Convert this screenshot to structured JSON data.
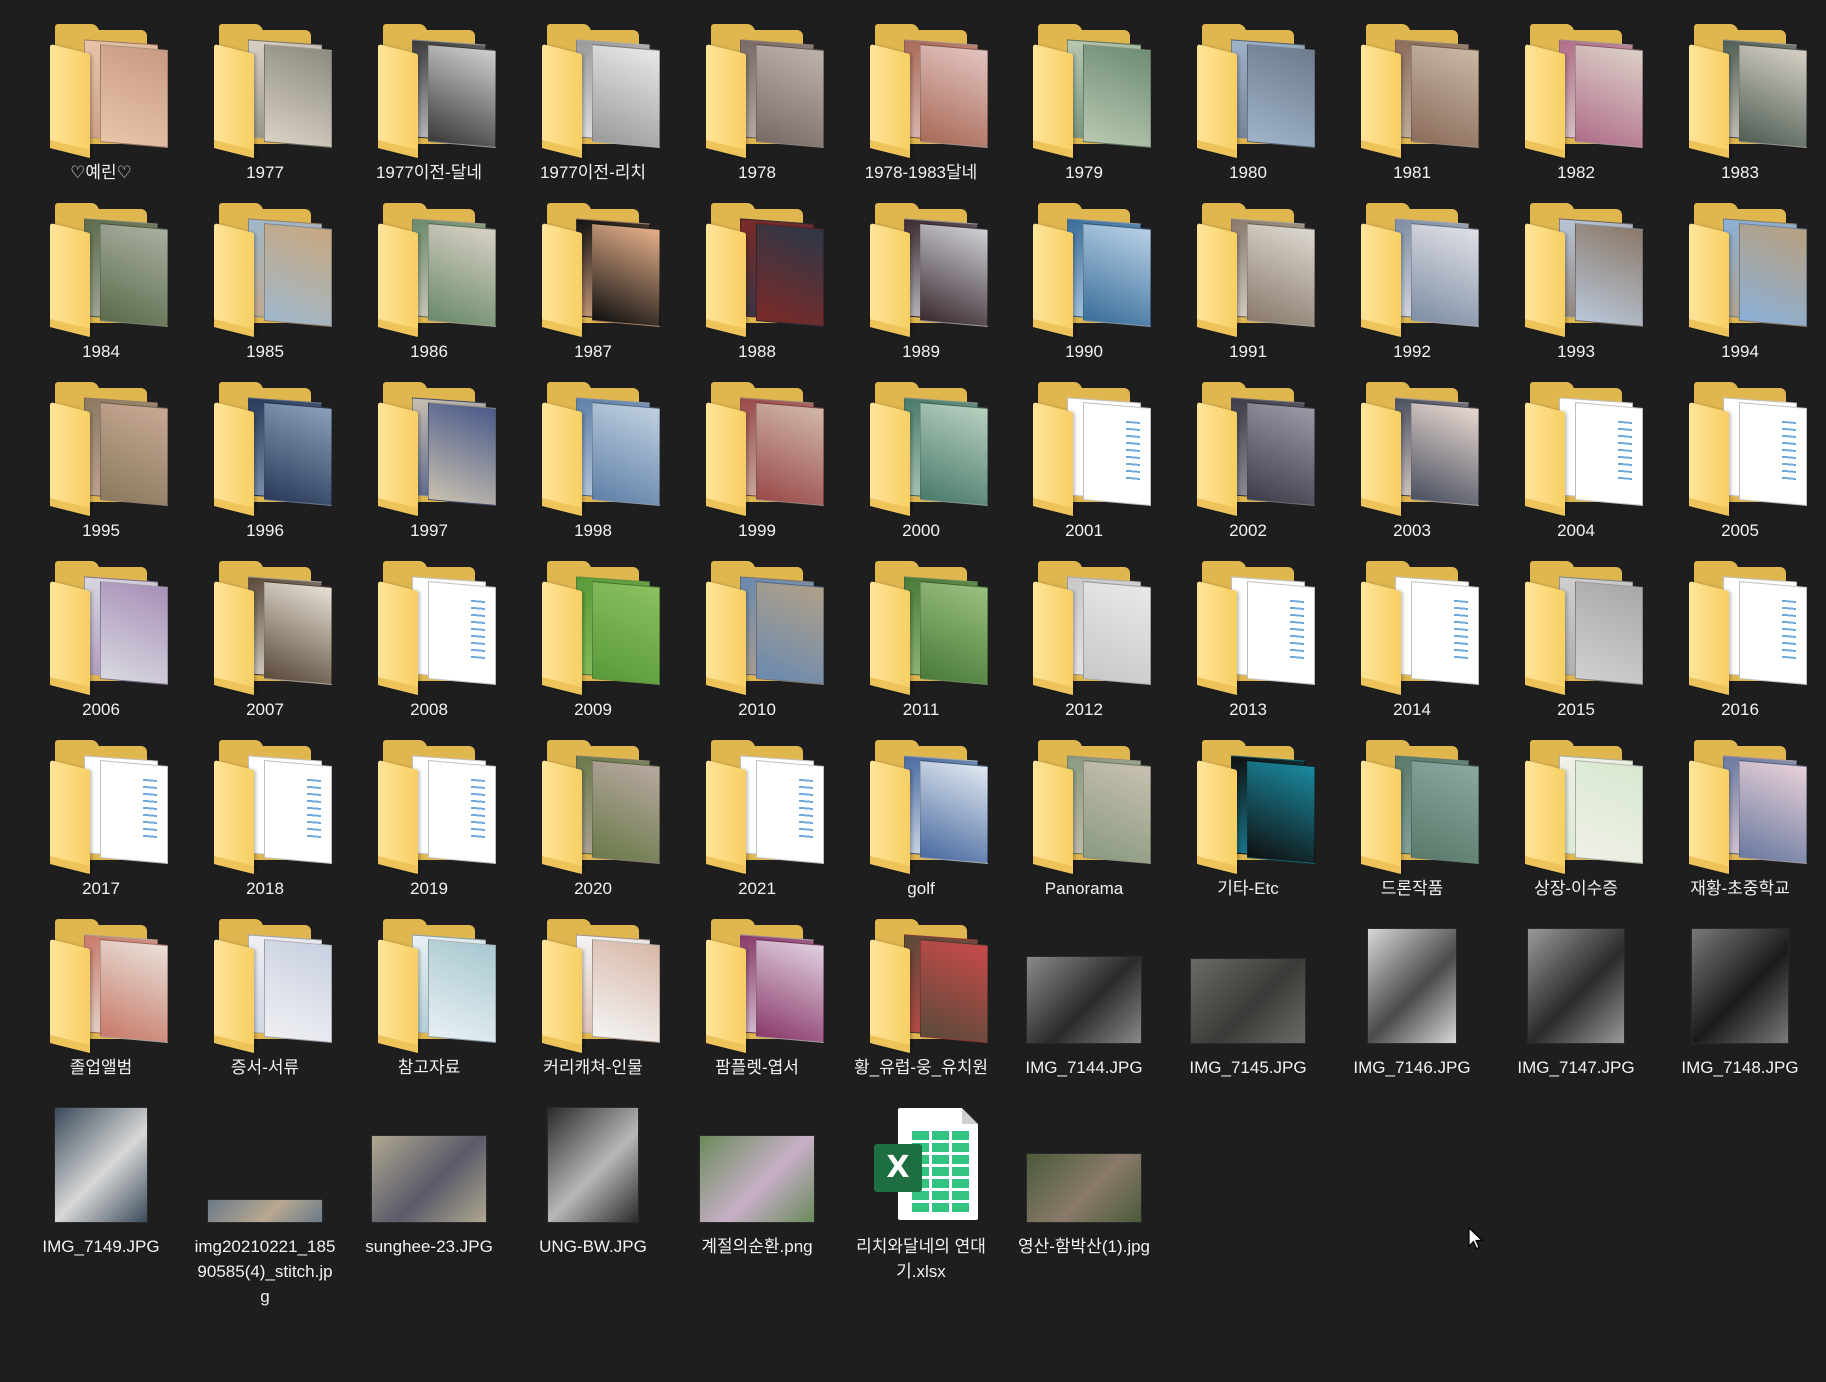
{
  "window": {
    "background": "#1e1e1e",
    "view_mode": "Large icons"
  },
  "items": [
    {
      "name": "♡예린♡",
      "type": "folder",
      "c1": "#e8c4a8",
      "c2": "#c99b84"
    },
    {
      "name": "1977",
      "type": "folder",
      "c1": "#d8d2c4",
      "c2": "#8f8a80"
    },
    {
      "name": "1977이전-달네",
      "type": "folder",
      "c1": "#3a3a3a",
      "c2": "#cfcfcf"
    },
    {
      "name": "1977이전-리치",
      "type": "folder",
      "c1": "#9a9a9a",
      "c2": "#e8e8e8"
    },
    {
      "name": "1978",
      "type": "folder",
      "c1": "#7a6a66",
      "c2": "#bdb3ab"
    },
    {
      "name": "1978-1983달네",
      "type": "folder",
      "c1": "#a86a58",
      "c2": "#e3c4c0"
    },
    {
      "name": "1979",
      "type": "folder",
      "c1": "#b9c8b0",
      "c2": "#6e8c74"
    },
    {
      "name": "1980",
      "type": "folder",
      "c1": "#9fb3c9",
      "c2": "#6e7c8e"
    },
    {
      "name": "1981",
      "type": "folder",
      "c1": "#8c6c5c",
      "c2": "#c8b8a4"
    },
    {
      "name": "1982",
      "type": "folder",
      "c1": "#b06e8a",
      "c2": "#dcd0c8"
    },
    {
      "name": "1983",
      "type": "folder",
      "c1": "#4f5e54",
      "c2": "#d6d0c6"
    },
    {
      "name": "1984",
      "type": "folder",
      "c1": "#5d6b4c",
      "c2": "#a8b0a0"
    },
    {
      "name": "1985",
      "type": "folder",
      "c1": "#9fb8cc",
      "c2": "#c8a880"
    },
    {
      "name": "1986",
      "type": "folder",
      "c1": "#6a8a6a",
      "c2": "#d8d0c4"
    },
    {
      "name": "1987",
      "type": "folder",
      "c1": "#111111",
      "c2": "#e6b08a"
    },
    {
      "name": "1988",
      "type": "folder",
      "c1": "#7c2a28",
      "c2": "#2c3848"
    },
    {
      "name": "1989",
      "type": "folder",
      "c1": "#3a2a30",
      "c2": "#cfcfd6"
    },
    {
      "name": "1990",
      "type": "folder",
      "c1": "#3a6e9a",
      "c2": "#b8d0e6"
    },
    {
      "name": "1991",
      "type": "folder",
      "c1": "#8a7a6c",
      "c2": "#dcd8d0"
    },
    {
      "name": "1992",
      "type": "folder",
      "c1": "#7e8ea4",
      "c2": "#e0e0e6"
    },
    {
      "name": "1993",
      "type": "folder",
      "c1": "#b8c6d8",
      "c2": "#8c7a6a"
    },
    {
      "name": "1994",
      "type": "folder",
      "c1": "#8ab0d8",
      "c2": "#b8a080"
    },
    {
      "name": "1995",
      "type": "folder",
      "c1": "#8a7a60",
      "c2": "#c8a894"
    },
    {
      "name": "1996",
      "type": "folder",
      "c1": "#2a3a5a",
      "c2": "#8aa0b8"
    },
    {
      "name": "1997",
      "type": "folder",
      "c1": "#c8c0b0",
      "c2": "#4a5a8a"
    },
    {
      "name": "1998",
      "type": "folder",
      "c1": "#6080a8",
      "c2": "#c0d0e0"
    },
    {
      "name": "1999",
      "type": "folder",
      "c1": "#9a4a4a",
      "c2": "#d0b8a8"
    },
    {
      "name": "2000",
      "type": "folder",
      "c1": "#4a7a6a",
      "c2": "#b8d0c0"
    },
    {
      "name": "2001",
      "type": "folder",
      "c1": "",
      "c2": ""
    },
    {
      "name": "2002",
      "type": "folder",
      "c1": "#3e3e4a",
      "c2": "#9a9aa6"
    },
    {
      "name": "2003",
      "type": "folder",
      "c1": "#4a5060",
      "c2": "#e8d8d0"
    },
    {
      "name": "2004",
      "type": "folder",
      "c1": "",
      "c2": ""
    },
    {
      "name": "2005",
      "type": "folder",
      "c1": "",
      "c2": ""
    },
    {
      "name": "2006",
      "type": "folder",
      "c1": "#d8d8e0",
      "c2": "#a890b8"
    },
    {
      "name": "2007",
      "type": "folder",
      "c1": "#5a4a3a",
      "c2": "#e6e0d4"
    },
    {
      "name": "2008",
      "type": "folder",
      "c1": "",
      "c2": ""
    },
    {
      "name": "2009",
      "type": "folder",
      "c1": "#5a9a3a",
      "c2": "#8ac060"
    },
    {
      "name": "2010",
      "type": "folder",
      "c1": "#6a8ab0",
      "c2": "#b0a088"
    },
    {
      "name": "2011",
      "type": "folder",
      "c1": "#4a7a3a",
      "c2": "#9ac080"
    },
    {
      "name": "2012",
      "type": "folder",
      "c1": "#c8c8c8",
      "c2": "#e8e8e8"
    },
    {
      "name": "2013",
      "type": "folder",
      "c1": "",
      "c2": ""
    },
    {
      "name": "2014",
      "type": "folder",
      "c1": "",
      "c2": ""
    },
    {
      "name": "2015",
      "type": "folder",
      "c1": "#d0d0d0",
      "c2": "#a8a8a8"
    },
    {
      "name": "2016",
      "type": "folder",
      "c1": "",
      "c2": ""
    },
    {
      "name": "2017",
      "type": "folder",
      "c1": "",
      "c2": ""
    },
    {
      "name": "2018",
      "type": "folder",
      "c1": "",
      "c2": ""
    },
    {
      "name": "2019",
      "type": "folder",
      "c1": "",
      "c2": ""
    },
    {
      "name": "2020",
      "type": "folder",
      "c1": "#6a7a4a",
      "c2": "#b8a8a0"
    },
    {
      "name": "2021",
      "type": "folder",
      "c1": "",
      "c2": ""
    },
    {
      "name": "golf",
      "type": "folder",
      "c1": "#4a6aa0",
      "c2": "#e0e8f0"
    },
    {
      "name": "Panorama",
      "type": "folder",
      "c1": "#8a9a80",
      "c2": "#c8c0b0"
    },
    {
      "name": "기타-Etc",
      "type": "folder",
      "c1": "#101010",
      "c2": "#1a8aa0"
    },
    {
      "name": "드론작품",
      "type": "folder",
      "c1": "#5a7a6a",
      "c2": "#8aa8a0"
    },
    {
      "name": "상장-이수증",
      "type": "folder",
      "c1": "#f0f0e8",
      "c2": "#d8e8d0"
    },
    {
      "name": "재황-초중학교",
      "type": "folder",
      "c1": "#6a7aa0",
      "c2": "#e8d0d8"
    },
    {
      "name": "졸업앨범",
      "type": "folder",
      "c1": "#c87a6a",
      "c2": "#e8e0d8"
    },
    {
      "name": "증서-서류",
      "type": "folder",
      "c1": "#f0f0f4",
      "c2": "#c8d0e0"
    },
    {
      "name": "참고자료",
      "type": "folder",
      "c1": "#e8f0f4",
      "c2": "#a8c8d0"
    },
    {
      "name": "커리캐쳐-인물",
      "type": "folder",
      "c1": "#f4f4f4",
      "c2": "#d8b8a8"
    },
    {
      "name": "팜플렛-엽서",
      "type": "folder",
      "c1": "#8a3a6a",
      "c2": "#e0d0e0"
    },
    {
      "name": "황_유럽-웅_유치원",
      "type": "folder",
      "c1": "#5a4a3a",
      "c2": "#c84a4a"
    },
    {
      "name": "IMG_7144.JPG",
      "type": "image",
      "w": 114,
      "h": 86,
      "c1": "#8a8a8a",
      "c2": "#2a2a2a"
    },
    {
      "name": "IMG_7145.JPG",
      "type": "image",
      "w": 114,
      "h": 84,
      "c1": "#6a6a66",
      "c2": "#3a3a38"
    },
    {
      "name": "IMG_7146.JPG",
      "type": "image",
      "w": 88,
      "h": 114,
      "c1": "#d8d8d8",
      "c2": "#4a4a4a"
    },
    {
      "name": "IMG_7147.JPG",
      "type": "image",
      "w": 96,
      "h": 114,
      "c1": "#9a9a9a",
      "c2": "#2a2a2a"
    },
    {
      "name": "IMG_7148.JPG",
      "type": "image",
      "w": 96,
      "h": 114,
      "c1": "#7a7a7a",
      "c2": "#1a1a1a"
    },
    {
      "name": "IMG_7149.JPG",
      "type": "image",
      "w": 92,
      "h": 114,
      "c1": "#3a4a5a",
      "c2": "#d8d8d8"
    },
    {
      "name": "img20210221_18590585(4)_stitch.jpg",
      "type": "image",
      "w": 114,
      "h": 22,
      "c1": "#6a7a8a",
      "c2": "#b8a890"
    },
    {
      "name": "sunghee-23.JPG",
      "type": "image",
      "w": 114,
      "h": 86,
      "c1": "#b0a890",
      "c2": "#5a5a6a"
    },
    {
      "name": "UNG-BW.JPG",
      "type": "image",
      "w": 90,
      "h": 114,
      "c1": "#2a2a2a",
      "c2": "#b8b8b8"
    },
    {
      "name": "계절의순환.png",
      "type": "image",
      "w": 114,
      "h": 86,
      "c1": "#6a8a5a",
      "c2": "#c8b0c8"
    },
    {
      "name": "리치와달네의 연대기.xlsx",
      "type": "excel"
    },
    {
      "name": "영산-함박산(1).jpg",
      "type": "image",
      "w": 114,
      "h": 68,
      "c1": "#4a5a3a",
      "c2": "#8a7a6a"
    }
  ]
}
